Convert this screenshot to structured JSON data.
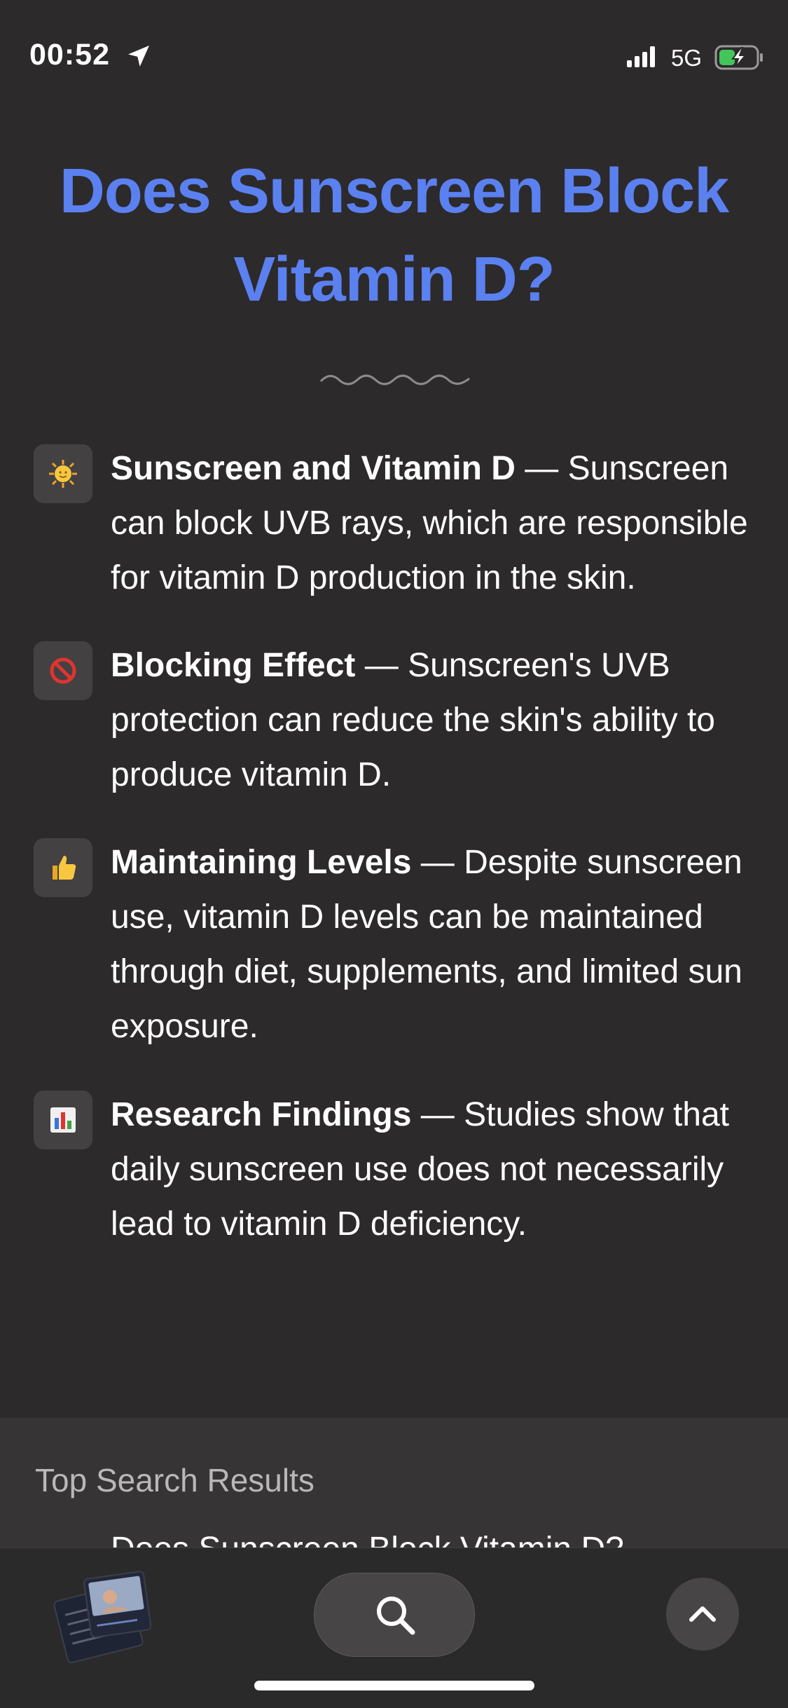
{
  "status_bar": {
    "time": "00:52",
    "network": "5G",
    "icons": [
      "location-arrow-icon",
      "signal-icon",
      "battery-charging-icon"
    ]
  },
  "page": {
    "title": "Does Sunscreen Block Vitamin D?",
    "title_color": "#5b80f0"
  },
  "facts": [
    {
      "icon": "sun-emoji-icon",
      "heading": "Sunscreen and Vitamin D",
      "separator": " — ",
      "body": "Sunscreen can block UVB rays, which are responsible for vitamin D production in the skin."
    },
    {
      "icon": "prohibited-emoji-icon",
      "heading": "Blocking Effect",
      "separator": " — ",
      "body": "Sunscreen's UVB protection can reduce the skin's ability to produce vitamin D."
    },
    {
      "icon": "thumbs-up-emoji-icon",
      "heading": "Maintaining Levels",
      "separator": " — ",
      "body": "Despite sunscreen use, vitamin D levels can be maintained through diet, supplements, and limited sun exposure."
    },
    {
      "icon": "bar-chart-emoji-icon",
      "heading": "Research Findings",
      "separator": " — ",
      "body": "Studies show that daily sunscreen use does not necessarily lead to vitamin D deficiency."
    }
  ],
  "results": {
    "heading": "Top Search Results",
    "first_item": "Does Sunscreen Block Vitamin D?"
  },
  "toolbar": {
    "icons": [
      "tab-thumbnails-icon",
      "search-icon",
      "chevron-up-icon"
    ]
  }
}
